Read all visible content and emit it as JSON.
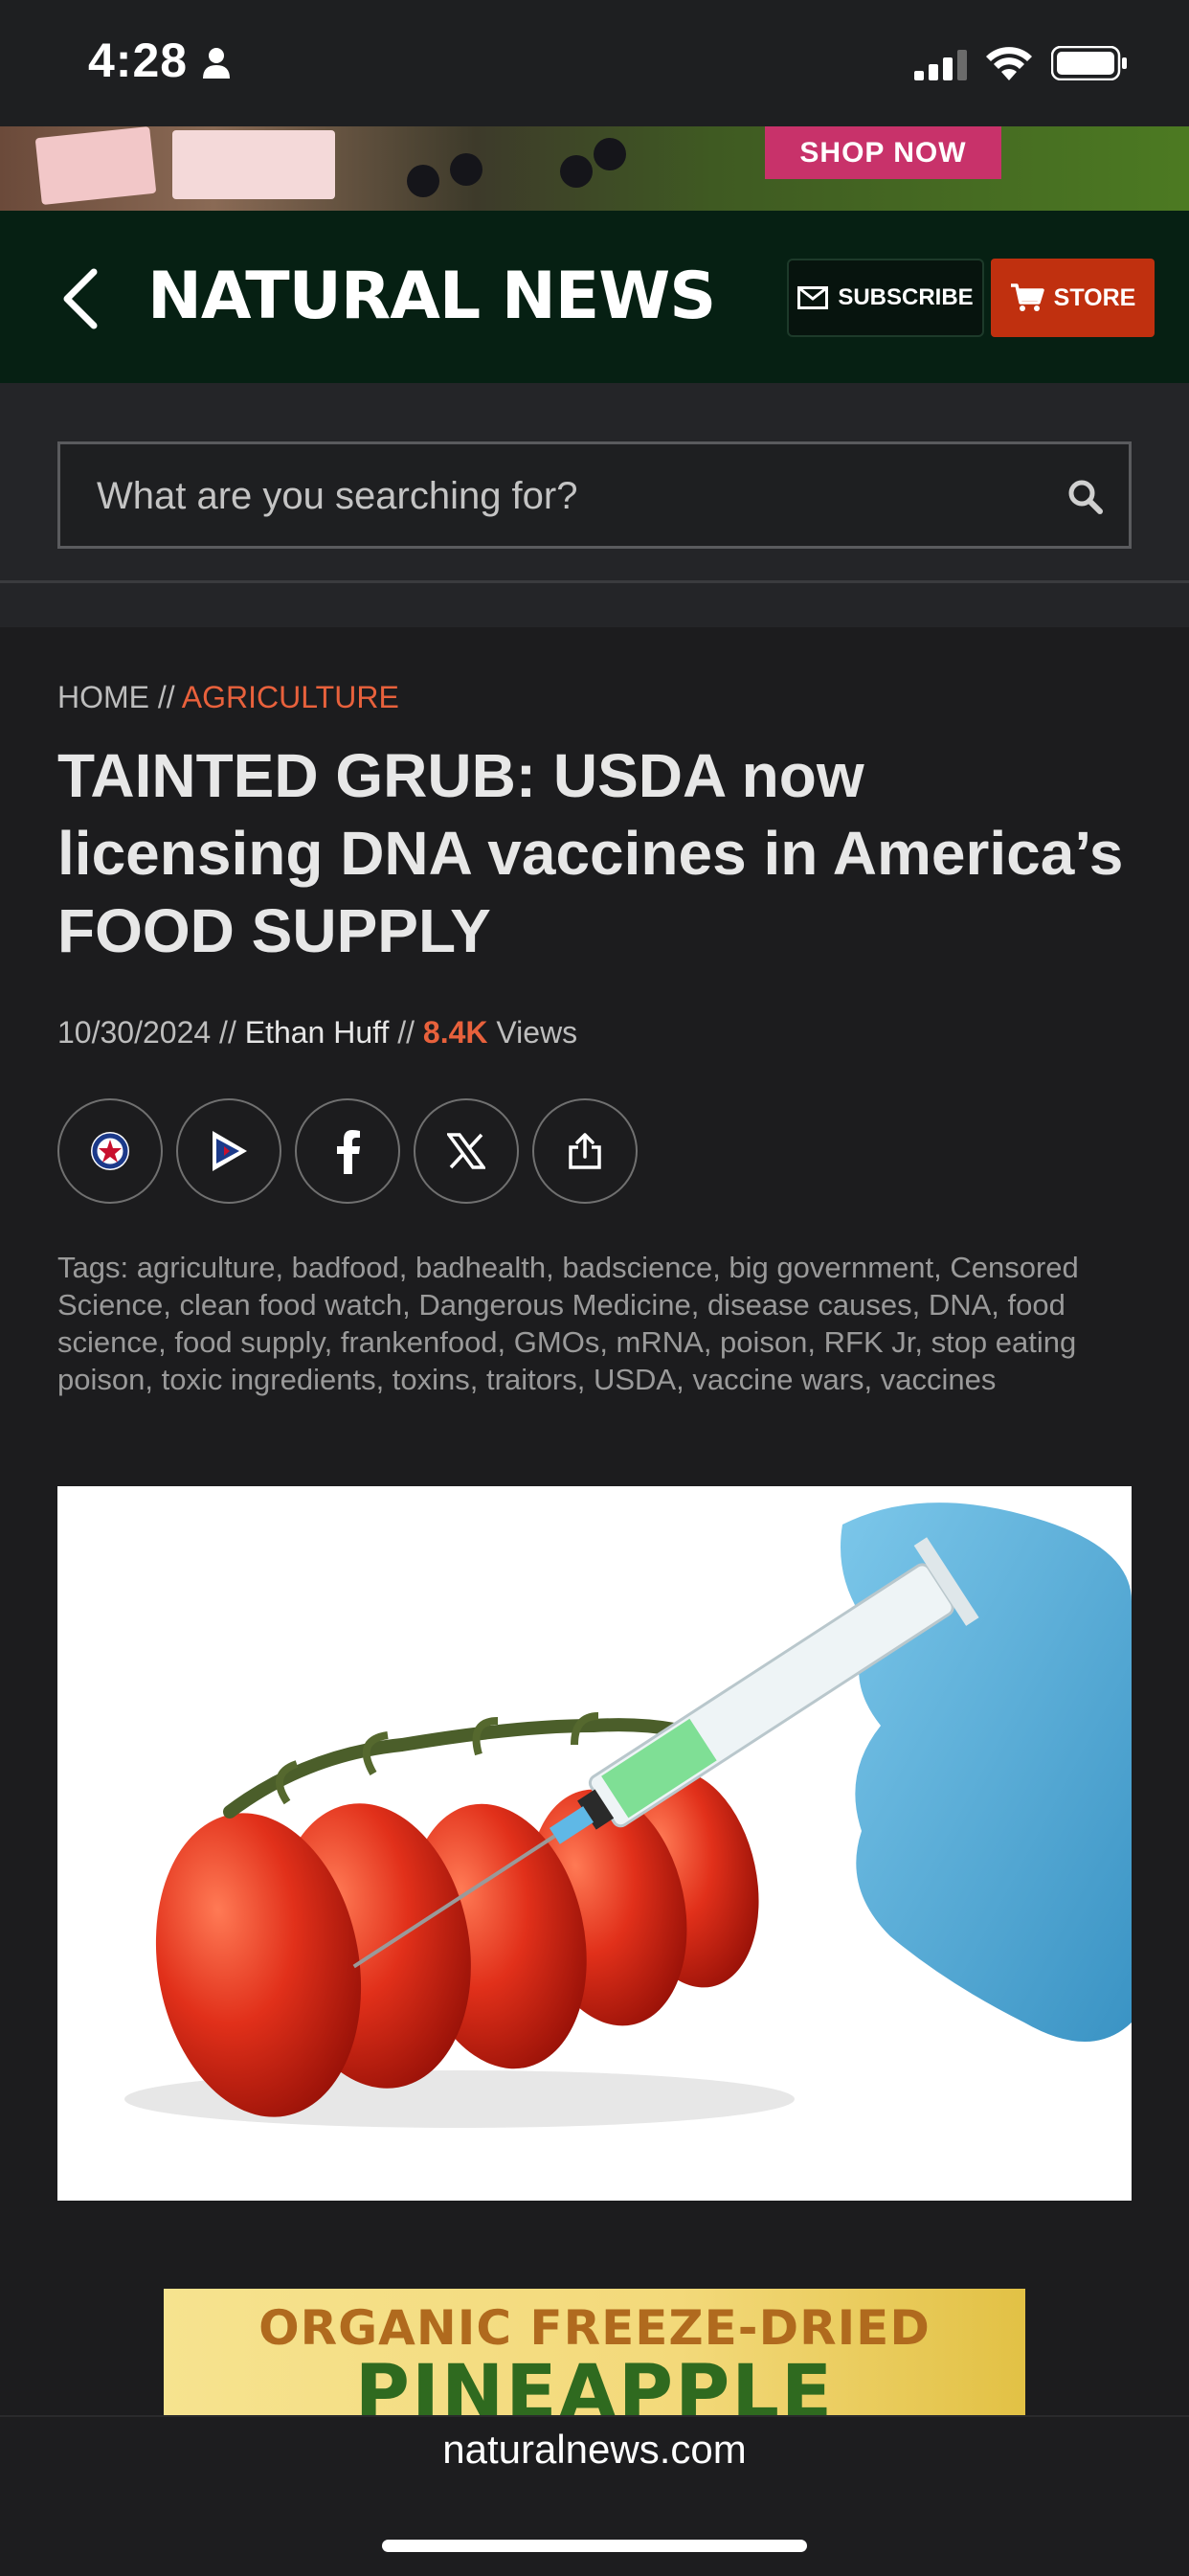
{
  "status_bar": {
    "time": "4:28"
  },
  "ad_banner": {
    "cta": "SHOP NOW"
  },
  "header": {
    "logo": "NATURAL NEWS",
    "subscribe_label": "SUBSCRIBE",
    "store_label": "STORE"
  },
  "search": {
    "placeholder": "What are you searching for?"
  },
  "article": {
    "breadcrumb": {
      "home": "HOME",
      "separator": " // ",
      "category": "AGRICULTURE"
    },
    "title": "TAINTED GRUB: USDA now licensing DNA vaccines in America’s FOOD SUPPLY",
    "date": "10/30/2024",
    "separator": " // ",
    "author": "Ethan Huff",
    "views_count": "8.4K",
    "views_label": " Views",
    "share_buttons": [
      "brighteon-icon",
      "truth-social-icon",
      "facebook-icon",
      "x-icon",
      "share-icon"
    ],
    "tags": "Tags: agriculture, badfood, badhealth, badscience, big government, Censored Science, clean food watch, Dangerous Medicine, disease causes, DNA, food science, food supply, frankenfood, GMOs, mRNA, poison, RFK Jr, stop eating poison, toxic ingredients, toxins, traitors, USDA, vaccine wars, vaccines"
  },
  "bottom_ad": {
    "line1": "ORGANIC FREEZE-DRIED",
    "line2": "PINEAPPLE"
  },
  "browser": {
    "url": "naturalnews.com"
  },
  "colors": {
    "accent": "#e8613c",
    "header_bg": "#062013",
    "store_red": "#c0300f",
    "shop_pink": "#c8326a"
  }
}
